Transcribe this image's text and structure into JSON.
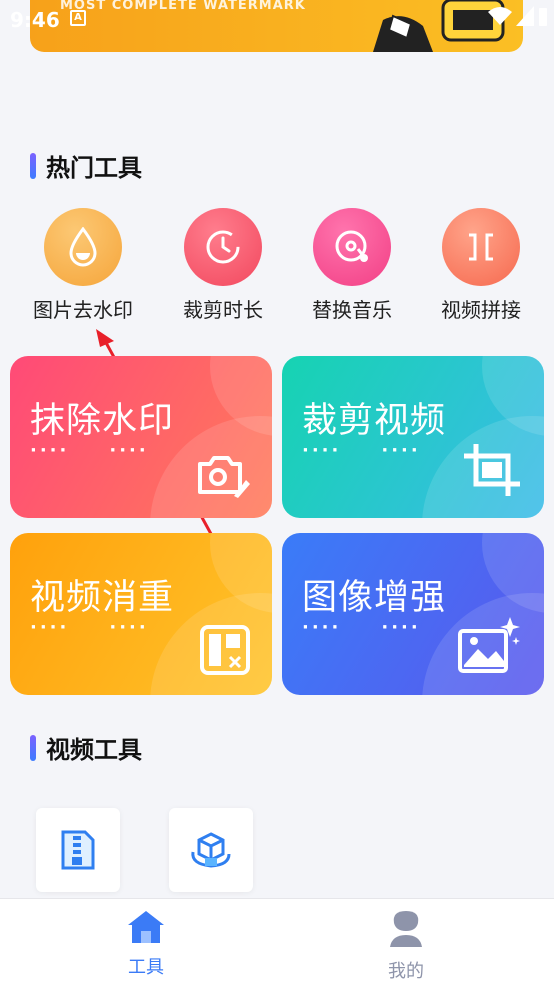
{
  "status_bar": {
    "time": "9:46",
    "notification_glyph": "A",
    "icons": [
      "wifi-icon",
      "signal-icon",
      "battery-icon"
    ]
  },
  "banner": {
    "text": "MOST COMPLETE WATERMARK"
  },
  "sections": {
    "hot_tools_title": "热门工具",
    "video_tools_title": "视频工具"
  },
  "hot_tools": [
    {
      "label": "图片去水印",
      "icon": "water-drop-icon",
      "color": "#f7b04a"
    },
    {
      "label": "裁剪时长",
      "icon": "timer-icon",
      "color": "#f5566b"
    },
    {
      "label": "替换音乐",
      "icon": "music-disc-icon",
      "color": "#f5468c"
    },
    {
      "label": "视频拼接",
      "icon": "video-join-icon",
      "color": "#f77c5f"
    }
  ],
  "feature_cards": [
    {
      "title": "抹除水印",
      "dots": "···· ····",
      "icon": "camera-erase-icon",
      "gradient": [
        "#ff4d7a",
        "#ff7a5c"
      ]
    },
    {
      "title": "裁剪视频",
      "dots": "···· ····",
      "icon": "crop-icon",
      "gradient": [
        "#1ecfb5",
        "#3cbfe6"
      ]
    },
    {
      "title": "视频消重",
      "dots": "···· ····",
      "icon": "dedupe-icon",
      "gradient": [
        "#ffa10f",
        "#ffbf2a"
      ]
    },
    {
      "title": "图像增强",
      "dots": "···· ····",
      "icon": "image-enhance-icon",
      "gradient": [
        "#3e7bfa",
        "#5a59ee"
      ]
    }
  ],
  "video_tools": [
    {
      "icon": "zip-file-icon"
    },
    {
      "icon": "3d-box-rotate-icon"
    }
  ],
  "bottom_nav": {
    "items": [
      {
        "label": "工具",
        "icon": "home-icon",
        "active": true,
        "color": "#3b7bf6"
      },
      {
        "label": "我的",
        "icon": "user-icon",
        "active": false,
        "color": "#8e94aa"
      }
    ]
  }
}
